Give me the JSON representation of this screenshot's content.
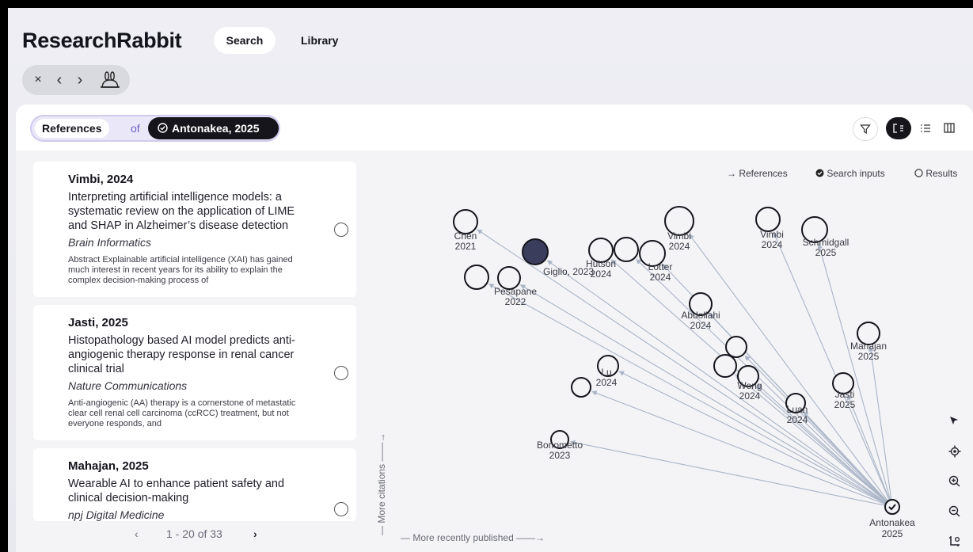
{
  "app": {
    "title": "ResearchRabbit",
    "nav": {
      "search": "Search",
      "library": "Library"
    },
    "history": {
      "close": "×",
      "back": "‹",
      "forward": "›"
    }
  },
  "header": {
    "mode": "References",
    "connector": "of",
    "seed": "Antonakea, 2025",
    "seed_icon": "seed-check-icon",
    "controls": [
      "filter-icon",
      "graph-view-icon",
      "list-view-icon",
      "columns-view-icon"
    ]
  },
  "papers": [
    {
      "author_year": "Vimbi, 2024",
      "title": "Interpreting artificial intelligence models: a systematic review on the application of LIME and SHAP in Alzheimer’s disease detection",
      "journal": "Brain Informatics",
      "abstract": "Abstract Explainable artificial intelligence (XAI) has gained much interest in recent years for its ability to explain the complex decision-making process of"
    },
    {
      "author_year": "Jasti, 2025",
      "title": "Histopathology based AI model predicts anti-angiogenic therapy response in renal cancer clinical trial",
      "journal": "Nature Communications",
      "abstract": "Anti-angiogenic (AA) therapy is a cornerstone of metastatic clear cell renal cell carcinoma (ccRCC) treatment, but not everyone responds, and"
    },
    {
      "author_year": "Mahajan, 2025",
      "title": "Wearable AI to enhance patient safety and clinical decision-making",
      "journal": "npj Digital Medicine",
      "abstract": ""
    }
  ],
  "pagination": {
    "prev": "‹",
    "range": "1 - 20 of 33",
    "next": "›"
  },
  "graph": {
    "legend": {
      "references": "References",
      "search_inputs": "Search inputs",
      "results": "Results"
    },
    "legend_icons": {
      "references": "arrow-right-icon",
      "search_inputs": "seed-icon",
      "results": "circle-icon"
    },
    "axis_y": "More citations",
    "axis_x": "More recently published",
    "colors": {
      "edge": "#a9b4c6",
      "node": "#14141c",
      "selected": "#3b3d5c"
    },
    "seed_node": {
      "name": "Antonakea",
      "year": "2025"
    },
    "nodes": [
      {
        "name": "Chen",
        "year": "2021"
      },
      {
        "name": "Giglio, 2023",
        "year": "",
        "selected": true
      },
      {
        "name": "Pesapane",
        "year": "2022"
      },
      {
        "name": "Hutson",
        "year": "2024"
      },
      {
        "name": "",
        "year": ""
      },
      {
        "name": "Lotter",
        "year": "2024"
      },
      {
        "name": "Vimbi",
        "year": "2024"
      },
      {
        "name": "Vimbi",
        "year": "2024"
      },
      {
        "name": "Schmidgall",
        "year": "2025"
      },
      {
        "name": "Abdollahi",
        "year": "2024"
      },
      {
        "name": "Mahajan",
        "year": "2025"
      },
      {
        "name": "",
        "year": ""
      },
      {
        "name": "",
        "year": ""
      },
      {
        "name": "Weng",
        "year": "2024"
      },
      {
        "name": "Jasti",
        "year": "2025"
      },
      {
        "name": "Lu",
        "year": "2024"
      },
      {
        "name": "",
        "year": ""
      },
      {
        "name": "Luan",
        "year": "2024"
      },
      {
        "name": "Bonometto",
        "year": "2023"
      },
      {
        "name": "",
        "year": ""
      }
    ]
  },
  "tools": [
    "pointer-icon",
    "locate-icon",
    "zoom-in-icon",
    "zoom-out-icon",
    "fit-layout-icon"
  ]
}
